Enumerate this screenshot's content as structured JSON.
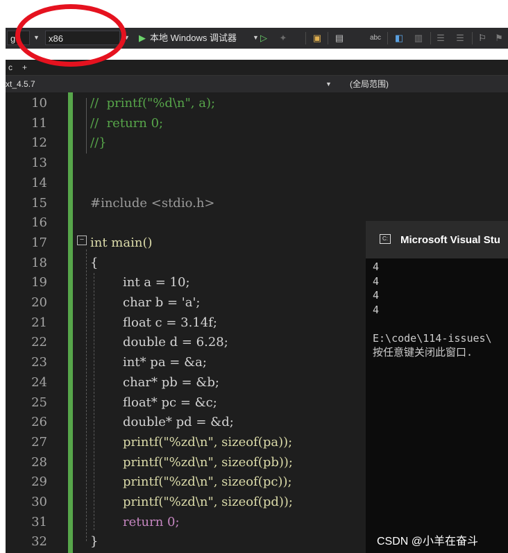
{
  "toolbar": {
    "config_value": "g",
    "platform_value": "x86",
    "run_label": "本地 Windows 调试器",
    "icons": [
      "play-icon",
      "start-without-debug-icon",
      "hot-reload-icon",
      "solution-explorer-icon",
      "window-layout-icon",
      "spellcheck-icon",
      "breakpoint-icon",
      "comment-icon",
      "bookmark-icon"
    ]
  },
  "tabs": {
    "left_label": "c",
    "pin_label": "+"
  },
  "navbar": {
    "project": "xt_4.5.7",
    "scope": "(全局范围)"
  },
  "editor": {
    "line_numbers": [
      "10",
      "11",
      "12",
      "13",
      "14",
      "15",
      "16",
      "17",
      "18",
      "19",
      "20",
      "21",
      "22",
      "23",
      "24",
      "25",
      "26",
      "27",
      "28",
      "29",
      "30",
      "31",
      "32"
    ],
    "lines": [
      "//  printf(\"%d\\n\", a);",
      "//  return 0;",
      "//}",
      "",
      "",
      "#include <stdio.h>",
      "",
      "int main()",
      "{",
      "int a = 10;",
      "char b = 'a';",
      "float c = 3.14f;",
      "double d = 6.28;",
      "int* pa = &a;",
      "char* pb = &b;",
      "float* pc = &c;",
      "double* pd = &d;",
      "printf(\"%zd\\n\", sizeof(pa));",
      "printf(\"%zd\\n\", sizeof(pb));",
      "printf(\"%zd\\n\", sizeof(pc));",
      "printf(\"%zd\\n\", sizeof(pd));",
      "return 0;",
      "}"
    ]
  },
  "console": {
    "title": "Microsoft Visual Stu",
    "output": [
      "4",
      "4",
      "4",
      "4",
      "",
      "E:\\code\\114-issues\\",
      "按任意键关闭此窗口."
    ]
  },
  "watermark": "CSDN @小羊在奋斗",
  "colors": {
    "annotation": "#e5121f",
    "change_bar": "#57a64a",
    "keyword": "#569cd6"
  }
}
